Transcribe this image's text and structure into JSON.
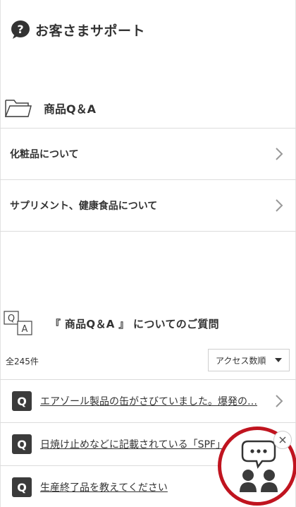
{
  "header": {
    "title": "お客さまサポート",
    "icon": "question-bubble-icon"
  },
  "section": {
    "title": "商品Q＆A",
    "icon": "folder-icon"
  },
  "categories": [
    {
      "label": "化粧品について"
    },
    {
      "label": "サプリメント、健康食品について"
    }
  ],
  "qa": {
    "title": "『 商品Q＆A 』 についてのご質問",
    "icon": "q-and-a-icon"
  },
  "count_label": "全245件",
  "sort": {
    "selected": "アクセス数順"
  },
  "badge_label": "Q",
  "questions": [
    {
      "text": "エアゾール製品の缶がさびていました。爆発の…"
    },
    {
      "text": "日焼け止めなどに記載されている「SPF」"
    },
    {
      "text": "生産終了品を教えてください"
    }
  ],
  "chat": {
    "accent": "#c0141f",
    "icon": "chat-operator-icon"
  }
}
